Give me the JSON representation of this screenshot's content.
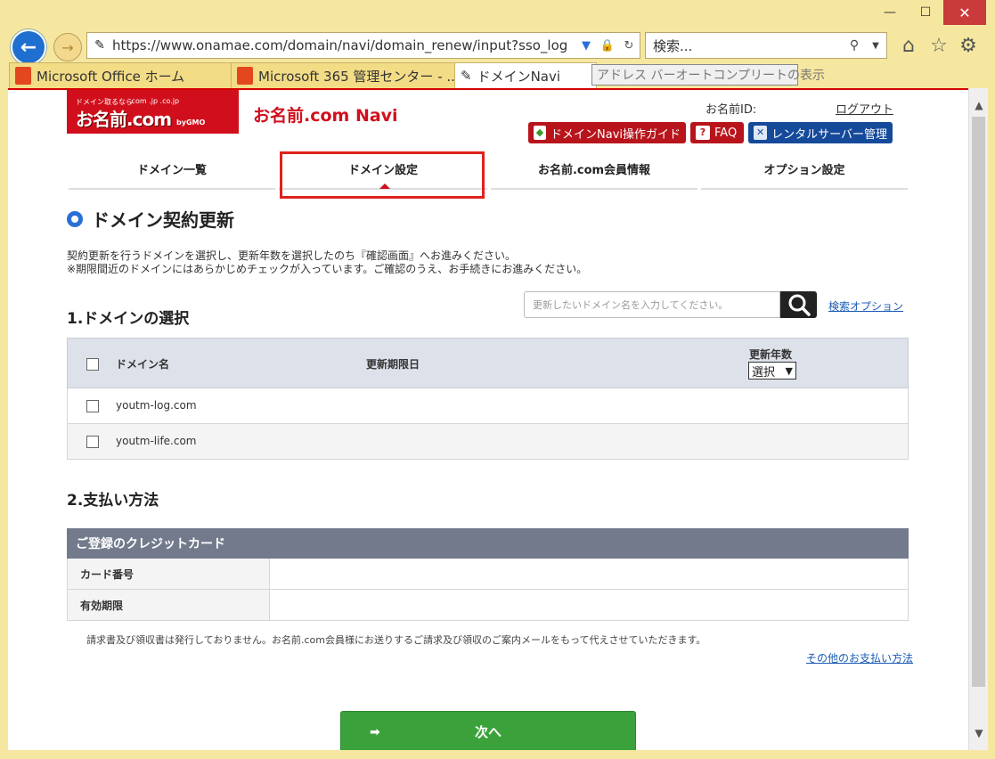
{
  "browser": {
    "url": "https://www.onamae.com/domain/navi/domain_renew/input?sso_log",
    "search_placeholder": "検索...",
    "tabs": [
      {
        "label": "Microsoft Office ホーム"
      },
      {
        "label": "Microsoft 365 管理センター - ..."
      },
      {
        "label": "ドメインNavi"
      }
    ],
    "tooltip": "アドレス バーオートコンプリートの表示",
    "tab_close": "×",
    "window_controls": {
      "minimize": "—",
      "maximize": "☐",
      "close": "✕"
    }
  },
  "header": {
    "logo_small": "ドメイン取るなら",
    "logo_big": "お名前.com",
    "logo_tlds": ".com .jp .co.jp",
    "logo_gmo": "byGMO",
    "site_name": "お名前.com Navi",
    "account_id_label": "お名前ID:",
    "logout": "ログアウト",
    "buttons": [
      {
        "label": "ドメインNavi操作ガイド",
        "color": "#b8141c"
      },
      {
        "label": "FAQ",
        "color": "#b8141c"
      },
      {
        "label": "レンタルサーバー管理",
        "color": "#154a9a"
      }
    ]
  },
  "nav": {
    "items": [
      {
        "label": "ドメイン一覧"
      },
      {
        "label": "ドメイン設定"
      },
      {
        "label": "お名前.com会員情報"
      },
      {
        "label": "オプション設定"
      }
    ]
  },
  "main": {
    "title": "ドメイン契約更新",
    "desc1": "契約更新を行うドメインを選択し、更新年数を選択したのち『確認画面』へお進みください。",
    "desc2": "※期限間近のドメインにはあらかじめチェックが入っています。ご確認のうえ、お手続きにお進みください。",
    "section1": "1.ドメインの選択",
    "search_placeholder": "更新したいドメイン名を入力してください。",
    "search_option": "検索オプション",
    "table": {
      "col_domain": "ドメイン名",
      "col_expiry": "更新期限日",
      "col_years": "更新年数",
      "years_select": "選択",
      "rows": [
        {
          "domain": "youtm-log.com",
          "expiry": ""
        },
        {
          "domain": "youtm-life.com",
          "expiry": ""
        }
      ]
    },
    "section2": "2.支払い方法",
    "card": {
      "header": "ご登録のクレジットカード",
      "number_label": "カード番号",
      "number_value": "",
      "expiry_label": "有効期限",
      "expiry_value": ""
    },
    "note": "請求書及び領収書は発行しておりません。お名前.com会員様にお送りするご請求及び領収のご案内メールをもって代えさせていただきます。",
    "other_payment": "その他のお支払い方法",
    "next": "次へ"
  },
  "colors": {
    "brand_red": "#d10f1c",
    "accent_blue": "#2a6fd6",
    "next_green": "#3ba23b"
  }
}
